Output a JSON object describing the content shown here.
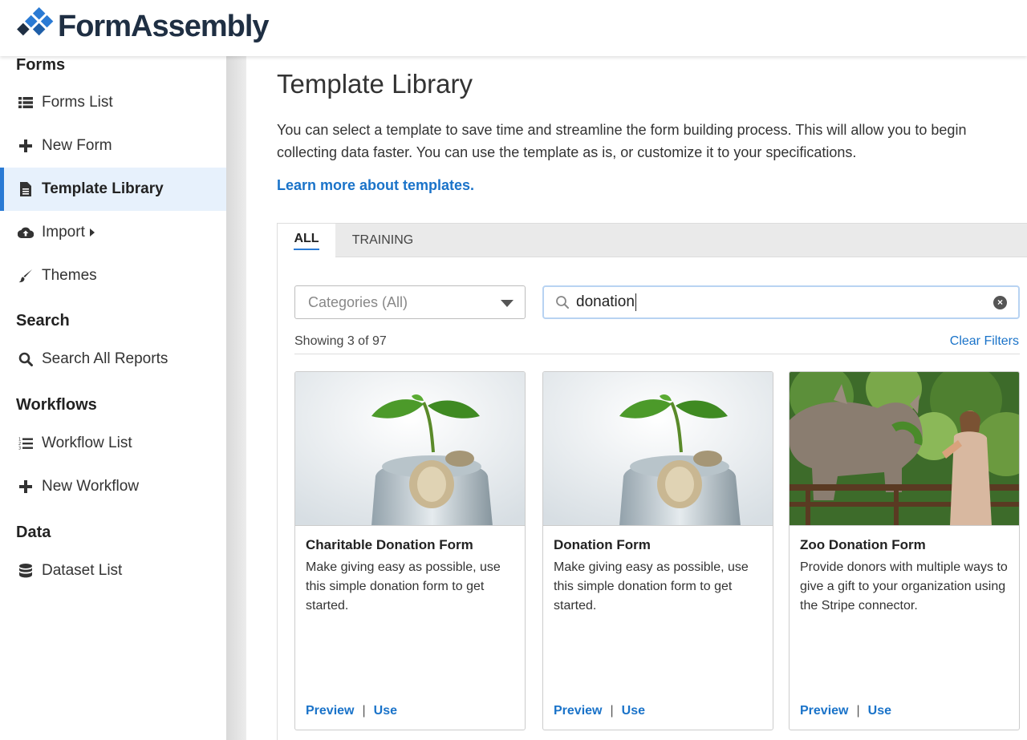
{
  "brand": {
    "name": "FormAssembly"
  },
  "sidebar": {
    "sections": [
      {
        "title": "Forms"
      },
      {
        "title": "Search"
      },
      {
        "title": "Workflows"
      },
      {
        "title": "Data"
      }
    ],
    "items": [
      {
        "label": "Forms List",
        "icon": "list-icon"
      },
      {
        "label": "New Form",
        "icon": "plus-icon"
      },
      {
        "label": "Template Library",
        "icon": "document-icon",
        "active": true
      },
      {
        "label": "Import",
        "icon": "cloud-upload-icon"
      },
      {
        "label": "Themes",
        "icon": "brush-icon"
      },
      {
        "label": "Search All Reports",
        "icon": "search-icon"
      },
      {
        "label": "Workflow List",
        "icon": "ordered-list-icon"
      },
      {
        "label": "New Workflow",
        "icon": "plus-icon"
      },
      {
        "label": "Dataset List",
        "icon": "database-icon"
      }
    ]
  },
  "main": {
    "title": "Template Library",
    "intro": "You can select a template to save time and streamline the form building process. This will allow you to begin collecting data faster. You can use the template as is, or customize it to your specifications.",
    "learn_more": "Learn more about templates.",
    "tabs": [
      {
        "label": "ALL",
        "active": true
      },
      {
        "label": "TRAINING"
      }
    ],
    "category_select": {
      "value": "Categories (All)"
    },
    "search": {
      "value": "donation"
    },
    "showing": "Showing 3 of 97",
    "clear_filters": "Clear Filters",
    "cards": [
      {
        "title": "Charitable Donation Form",
        "description": "Make giving easy as possible, use this simple donation form to get started.",
        "image": "plant-in-coin-jar",
        "preview": "Preview",
        "separator": "|",
        "use": "Use"
      },
      {
        "title": "Donation Form",
        "description": "Make giving easy as possible, use this simple donation form to get started.",
        "image": "plant-in-coin-jar",
        "preview": "Preview",
        "separator": "|",
        "use": "Use"
      },
      {
        "title": "Zoo Donation Form",
        "description": "Provide donors with multiple ways to give a gift to your organization using the Stripe connector.",
        "image": "rhino-feeding",
        "preview": "Preview",
        "separator": "|",
        "use": "Use"
      }
    ]
  },
  "colors": {
    "accent": "#2a7ad4",
    "link": "#1a73c9",
    "active_bg": "#e7f1fc",
    "brand_dark": "#1f2f43"
  }
}
